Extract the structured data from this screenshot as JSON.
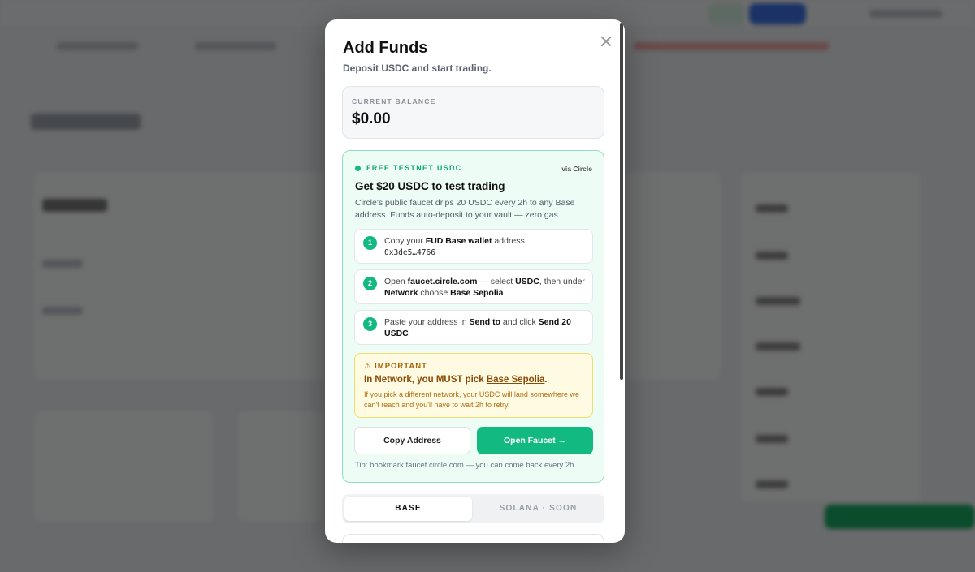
{
  "modal": {
    "title": "Add Funds",
    "subtitle": "Deposit USDC and start trading.",
    "balance": {
      "label": "CURRENT BALANCE",
      "value": "$0.00"
    },
    "faucet": {
      "badge": "FREE TESTNET USDC",
      "via": "via Circle",
      "heading": "Get $20 USDC to test trading",
      "description": "Circle's public faucet drips 20 USDC every 2h to any Base address. Funds auto-deposit to your vault — zero gas.",
      "steps": [
        {
          "num": "1",
          "a": "Copy your ",
          "b": "FUD Base wallet",
          "c": " address",
          "address": "0x3de5…4766"
        },
        {
          "num": "2",
          "a": "Open ",
          "b": "faucet.circle.com",
          "c": " — select ",
          "d": "USDC",
          "e": ", then under ",
          "f": "Network",
          "g": " choose ",
          "h": "Base Sepolia"
        },
        {
          "num": "3",
          "a": "Paste your address in ",
          "b": "Send to",
          "c": " and click ",
          "d": "Send 20 USDC"
        }
      ],
      "important": {
        "heading": "⚠ IMPORTANT",
        "msg_a": "In Network, you MUST pick ",
        "msg_b": "Base Sepolia",
        "msg_c": ".",
        "detail": "If you pick a different network, your USDC will land somewhere we can't reach and you'll have to wait 2h to retry."
      },
      "copy_button": "Copy Address",
      "open_button": "Open Faucet →",
      "tip": "Tip: bookmark faucet.circle.com — you can come back every 2h."
    },
    "tabs": [
      {
        "label": "BASE"
      },
      {
        "label": "SOLANA · SOON"
      }
    ]
  },
  "colors": {
    "accent": "#12b981",
    "warning": "#a6600a",
    "overlay": "rgba(0,0,0,0.55)"
  },
  "icons": {
    "close": "close-icon",
    "warning": "warning-icon"
  }
}
